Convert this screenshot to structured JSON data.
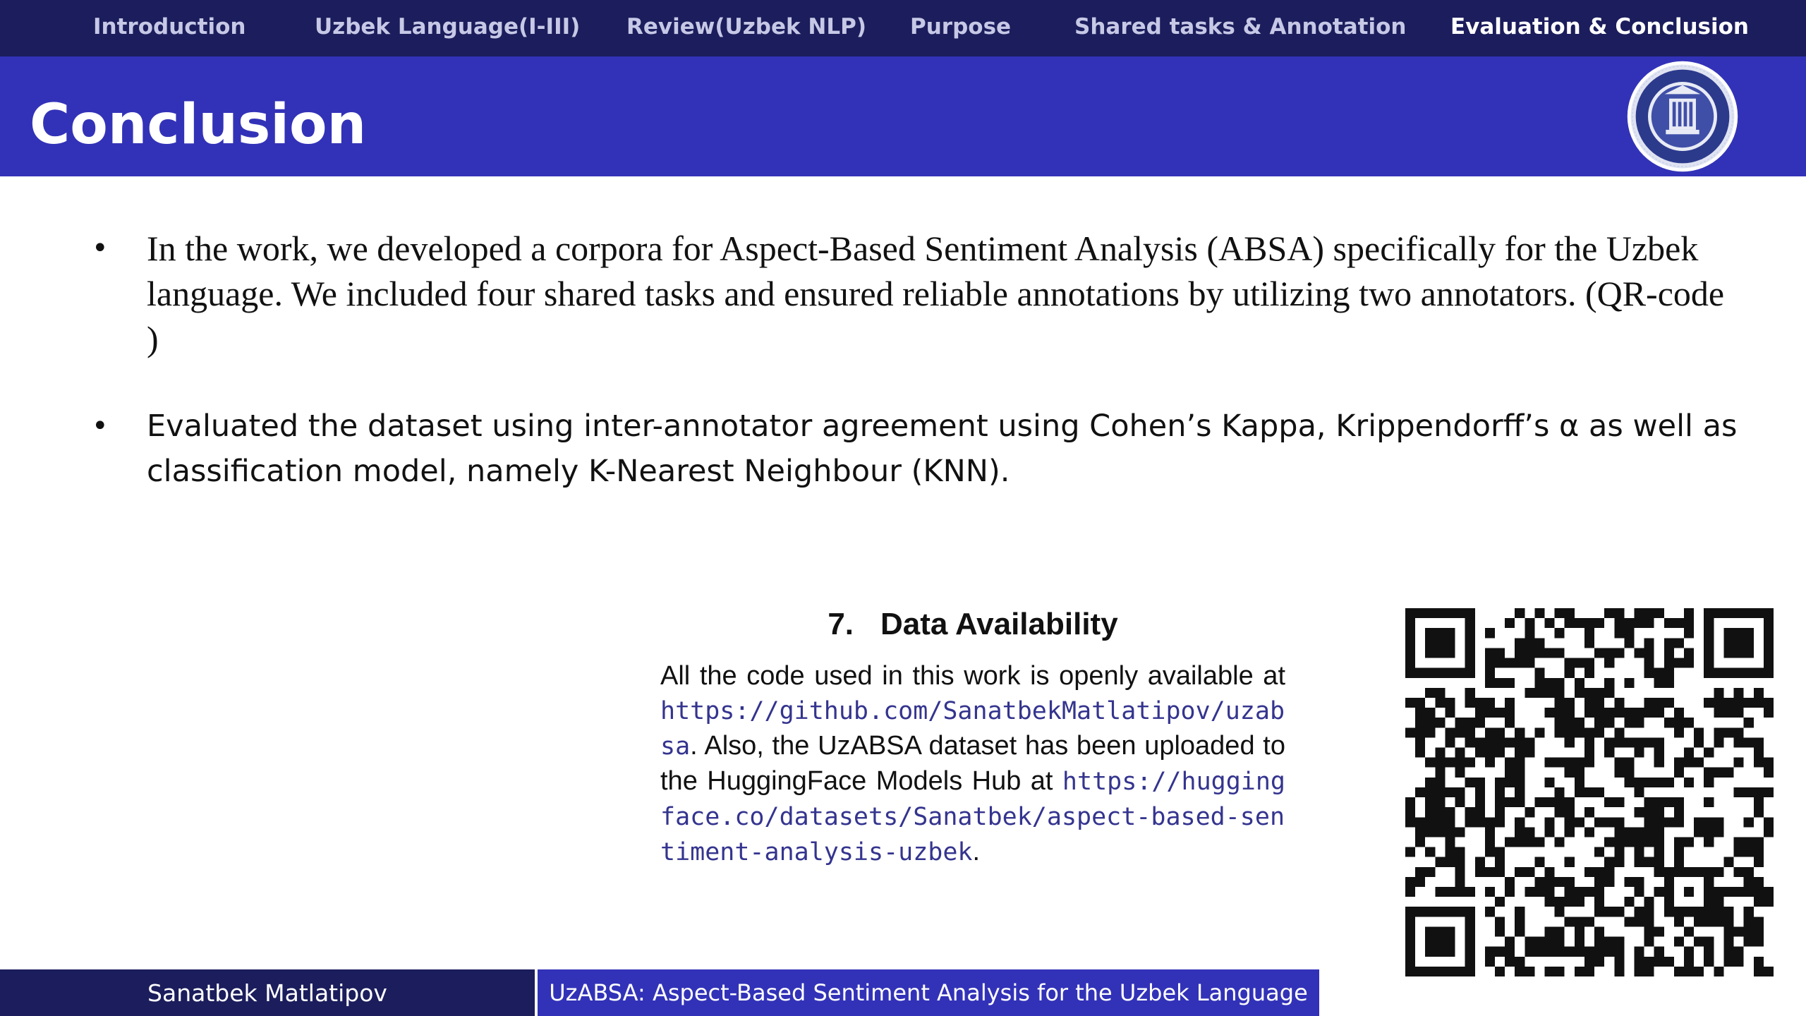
{
  "nav": {
    "items": [
      {
        "label": "Introduction",
        "active": false
      },
      {
        "label": "Uzbek Language(I-III)",
        "active": false
      },
      {
        "label": "Review(Uzbek NLP)",
        "active": false
      },
      {
        "label": "Purpose",
        "active": false
      },
      {
        "label": "Shared tasks & Annotation",
        "active": false
      },
      {
        "label": "Evaluation & Conclusion",
        "active": true
      }
    ]
  },
  "slide": {
    "title": "Conclusion",
    "bullets": [
      "In the work, we developed a corpora for Aspect-Based Sentiment Analysis (ABSA) specifically for the Uzbek language. We included four shared tasks and ensured reliable annotations by utilizing two annotators. (QR-code )",
      "Evaluated the dataset using inter-annotator agreement using Cohen’s Kappa, Krippendorff’s α as well as classification model, namely K-Nearest Neighbour (KNN)."
    ]
  },
  "data_availability": {
    "number": "7.",
    "heading": "Data Availability",
    "text_1": "All the code used in this work is openly available at ",
    "link_1": "https://github.com/SanatbekMatlatipov/uzabsa",
    "text_2": ". Also, the UzABSA dataset has been uploaded to the HuggingFace Models Hub at ",
    "link_2": "https://huggingface.co/datasets/Sanatbek/aspect-based-sentiment-analysis-uzbek",
    "text_3": "."
  },
  "footer": {
    "author": "Sanatbek Matlatipov",
    "paper_title": "UzABSA: Aspect-Based Sentiment Analysis for the Uzbek Language"
  },
  "colors": {
    "nav_bg": "#1b1d5c",
    "title_bg": "#3232b8",
    "link": "#34348f"
  }
}
